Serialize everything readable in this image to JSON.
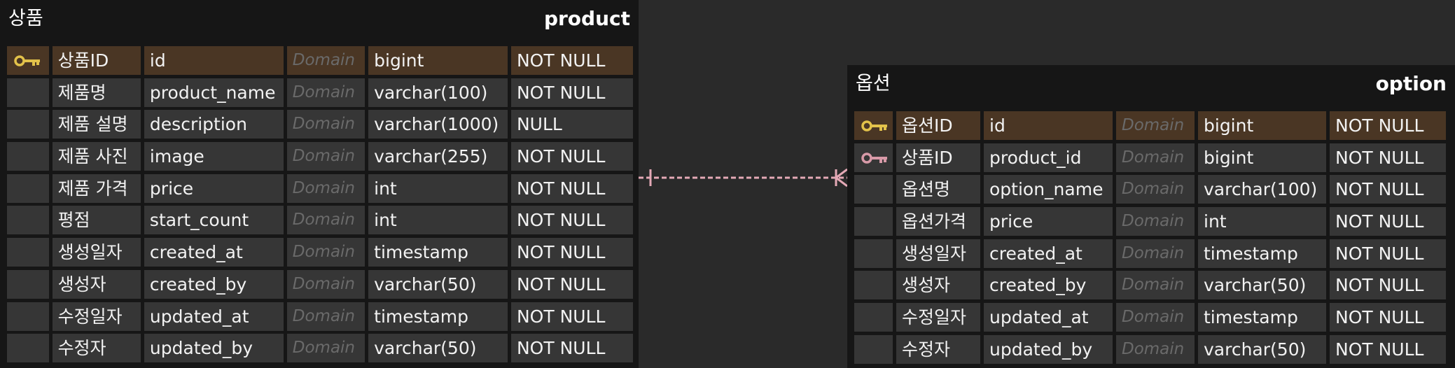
{
  "colors": {
    "pk_key": "#e3c24a",
    "fk_key": "#d89aa8",
    "relationship": "#e4a9b6",
    "pk_row": "#4a3624"
  },
  "product": {
    "logical_name": "상품",
    "physical_name": "product",
    "columns": [
      {
        "key": "pk-key-icon",
        "logical": "상품ID",
        "physical": "id",
        "domain": "Domain",
        "type": "bigint",
        "nullable": "NOT NULL"
      },
      {
        "key": "",
        "logical": "제품명",
        "physical": "product_name",
        "domain": "Domain",
        "type": "varchar(100)",
        "nullable": "NOT NULL"
      },
      {
        "key": "",
        "logical": "제품 설명",
        "physical": "description",
        "domain": "Domain",
        "type": "varchar(1000)",
        "nullable": "NULL"
      },
      {
        "key": "",
        "logical": "제품 사진",
        "physical": "image",
        "domain": "Domain",
        "type": "varchar(255)",
        "nullable": "NOT NULL"
      },
      {
        "key": "",
        "logical": "제품 가격",
        "physical": "price",
        "domain": "Domain",
        "type": "int",
        "nullable": "NOT NULL"
      },
      {
        "key": "",
        "logical": "평점",
        "physical": "start_count",
        "domain": "Domain",
        "type": "int",
        "nullable": "NOT NULL"
      },
      {
        "key": "",
        "logical": "생성일자",
        "physical": "created_at",
        "domain": "Domain",
        "type": "timestamp",
        "nullable": "NOT NULL"
      },
      {
        "key": "",
        "logical": "생성자",
        "physical": "created_by",
        "domain": "Domain",
        "type": "varchar(50)",
        "nullable": "NOT NULL"
      },
      {
        "key": "",
        "logical": "수정일자",
        "physical": "updated_at",
        "domain": "Domain",
        "type": "timestamp",
        "nullable": "NOT NULL"
      },
      {
        "key": "",
        "logical": "수정자",
        "physical": "updated_by",
        "domain": "Domain",
        "type": "varchar(50)",
        "nullable": "NOT NULL"
      }
    ]
  },
  "option": {
    "logical_name": "옵션",
    "physical_name": "option",
    "columns": [
      {
        "key": "pk-key-icon",
        "logical": "옵션ID",
        "physical": "id",
        "domain": "Domain",
        "type": "bigint",
        "nullable": "NOT NULL"
      },
      {
        "key": "fk-key-icon",
        "logical": "상품ID",
        "physical": "product_id",
        "domain": "Domain",
        "type": "bigint",
        "nullable": "NOT NULL"
      },
      {
        "key": "",
        "logical": "옵션명",
        "physical": "option_name",
        "domain": "Domain",
        "type": "varchar(100)",
        "nullable": "NOT NULL"
      },
      {
        "key": "",
        "logical": "옵션가격",
        "physical": "price",
        "domain": "Domain",
        "type": "int",
        "nullable": "NOT NULL"
      },
      {
        "key": "",
        "logical": "생성일자",
        "physical": "created_at",
        "domain": "Domain",
        "type": "timestamp",
        "nullable": "NOT NULL"
      },
      {
        "key": "",
        "logical": "생성자",
        "physical": "created_by",
        "domain": "Domain",
        "type": "varchar(50)",
        "nullable": "NOT NULL"
      },
      {
        "key": "",
        "logical": "수정일자",
        "physical": "updated_at",
        "domain": "Domain",
        "type": "timestamp",
        "nullable": "NOT NULL"
      },
      {
        "key": "",
        "logical": "수정자",
        "physical": "updated_by",
        "domain": "Domain",
        "type": "varchar(50)",
        "nullable": "NOT NULL"
      }
    ]
  },
  "relationship": {
    "from_entity": "product",
    "to_entity": "option",
    "from_cardinality": "one",
    "to_cardinality": "many",
    "line_style": "dashed"
  }
}
